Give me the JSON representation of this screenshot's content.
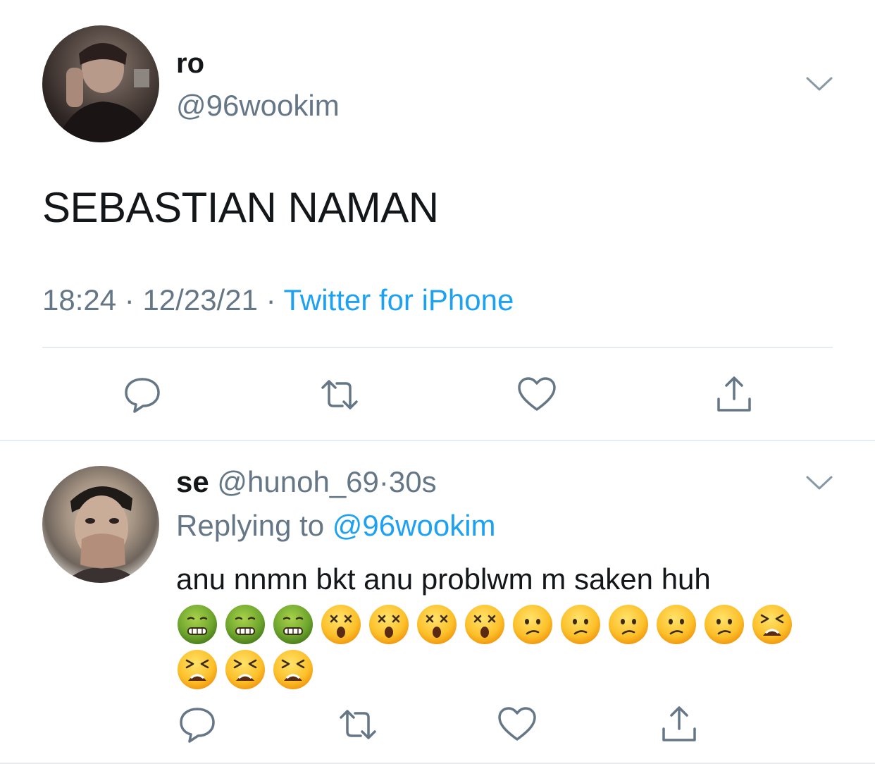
{
  "tweet": {
    "author_name": "ro",
    "author_handle": "@96wookim",
    "text": "SEBASTIAN NAMAN",
    "time": "18:24",
    "date": "12/23/21",
    "sep": "·",
    "source": "Twitter for iPhone"
  },
  "reply": {
    "author_name": "se",
    "author_handle": "@hunoh_69",
    "sep": "·",
    "age": "30s",
    "replying_label": "Replying to",
    "replying_to": "@96wookim",
    "text": "anu nnmn bkt anu problwm m saken huh",
    "emojis_line1": [
      "nauseated-face",
      "nauseated-face",
      "nauseated-face",
      "dizzy-face",
      "dizzy-face",
      "dizzy-face",
      "dizzy-face",
      "confused-face",
      "confused-face",
      "confused-face",
      "confused-face",
      "confused-face",
      "tired-face"
    ],
    "emojis_line2": [
      "tired-face",
      "tired-face",
      "tired-face"
    ]
  },
  "colors": {
    "text": "#14171a",
    "secondary": "#657786",
    "accent": "#1da1f2",
    "divider": "#e6ecf0"
  },
  "icons": [
    "chevron-down-icon",
    "reply-icon",
    "retweet-icon",
    "like-icon",
    "share-icon"
  ]
}
